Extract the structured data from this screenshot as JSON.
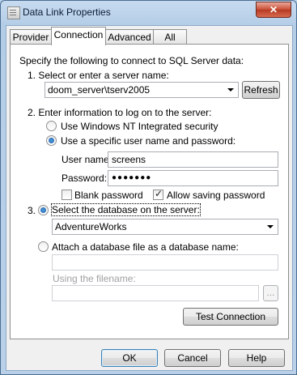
{
  "window": {
    "title": "Data Link Properties",
    "close_label": "✕"
  },
  "tabs": [
    {
      "label": "Provider"
    },
    {
      "label": "Connection"
    },
    {
      "label": "Advanced"
    },
    {
      "label": "All"
    }
  ],
  "connection": {
    "intro": "Specify the following to connect to SQL Server data:",
    "step1_label": "1. Select or enter a server name:",
    "server_name": "doom_server\\tserv2005",
    "refresh_label": "Refresh",
    "step2_label": "2. Enter information to log on to the server:",
    "radio_windows_label": "Use Windows NT Integrated security",
    "radio_specific_label": "Use a specific user name and password:",
    "username_label": "User name:",
    "username_value": "screens",
    "password_label": "Password:",
    "password_value": "●●●●●●●",
    "blank_password_label": "Blank password",
    "allow_saving_label": "Allow saving password",
    "step3_number": "3.",
    "radio_select_db_label": "Select the database on the server:",
    "database_value": "AdventureWorks",
    "radio_attach_label": "Attach a database file as a database name:",
    "attach_name_value": "",
    "filename_label": "Using the filename:",
    "filename_value": "",
    "browse_label": "...",
    "test_connection_label": "Test Connection"
  },
  "footer": {
    "ok_label": "OK",
    "cancel_label": "Cancel",
    "help_label": "Help"
  }
}
